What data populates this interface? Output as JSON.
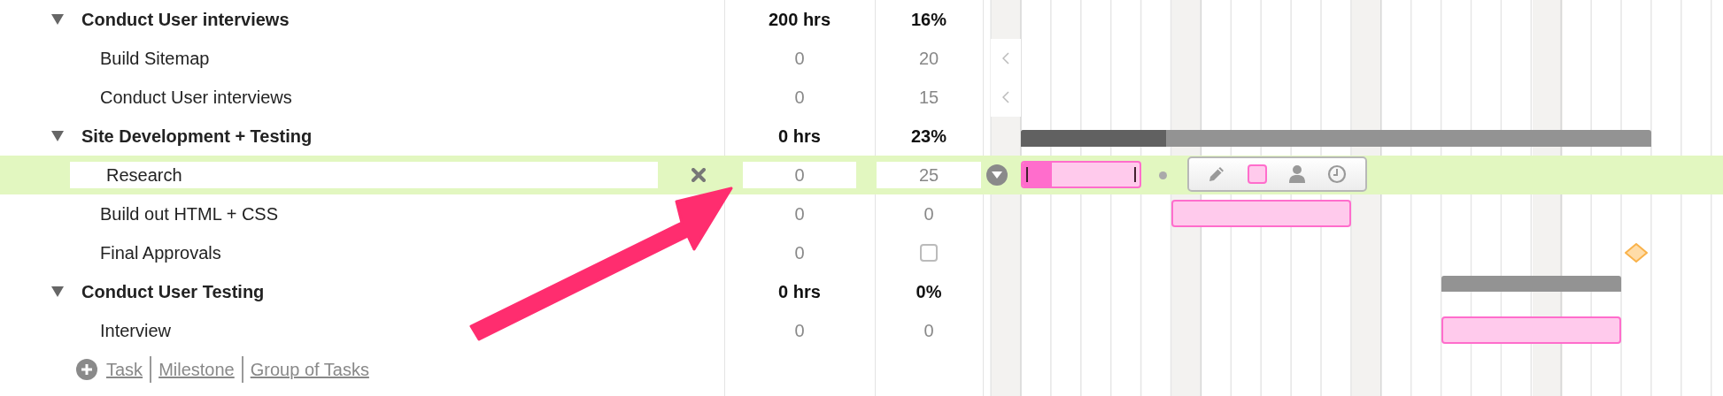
{
  "rows": [
    {
      "kind": "group",
      "name": "Conduct User interviews",
      "hours": "200 hrs",
      "percent": "16%",
      "expanded": true,
      "selected": false
    },
    {
      "kind": "task",
      "name": "Build Sitemap",
      "hours": "0",
      "percent": "20",
      "selected": false,
      "bar_before_view": true
    },
    {
      "kind": "task",
      "name": "Conduct User interviews",
      "hours": "0",
      "percent": "15",
      "selected": false,
      "bar_before_view": true
    },
    {
      "kind": "group",
      "name": "Site Development + Testing",
      "hours": "0 hrs",
      "percent": "23%",
      "expanded": true,
      "selected": false,
      "bar": {
        "level": 0.23
      }
    },
    {
      "kind": "task",
      "name": "Research",
      "hours": "0",
      "percent": "25",
      "selected": true,
      "bar": {
        "level": 0.25
      }
    },
    {
      "kind": "task",
      "name": "Build out HTML + CSS",
      "hours": "0",
      "percent": "0",
      "selected": false,
      "bar": {}
    },
    {
      "kind": "milestone",
      "name": "Final Approvals",
      "hours": "0",
      "done": false,
      "selected": false
    },
    {
      "kind": "group",
      "name": "Conduct User Testing",
      "hours": "0 hrs",
      "percent": "0%",
      "expanded": true,
      "selected": false,
      "bar": {}
    },
    {
      "kind": "task",
      "name": "Interview",
      "hours": "0",
      "percent": "0",
      "selected": false,
      "bar": {}
    }
  ],
  "add_links": [
    "Task",
    "Milestone",
    "Group of Tasks"
  ]
}
